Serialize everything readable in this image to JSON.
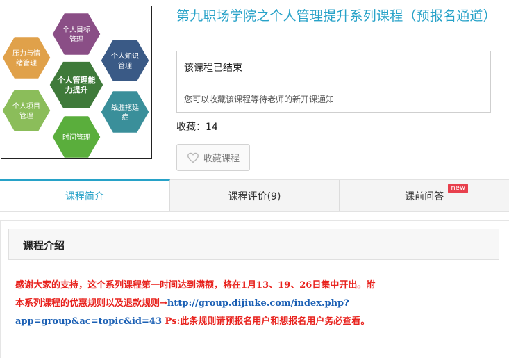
{
  "course": {
    "title": "第九职场学院之个人管理提升系列课程（预报名通道）",
    "ended_title": "该课程已结束",
    "ended_sub": "您可以收藏该课程等待老师的新开课通知",
    "fav_count_label": "收藏：14",
    "fav_button_label": "收藏课程"
  },
  "thumbnail": {
    "center": [
      "个人管理能",
      "力提升"
    ],
    "top": [
      "个人目标",
      "管理"
    ],
    "top_right": [
      "个人知识",
      "管理"
    ],
    "bottom_right": [
      "战胜拖延",
      "症"
    ],
    "bottom": [
      "时间管理"
    ],
    "bottom_left": [
      "个人项目",
      "管理"
    ],
    "top_left": [
      "压力与情",
      "绪管理"
    ],
    "colors": {
      "center": "#3f7a3a",
      "top": "#8a4e86",
      "top_right": "#3a5a86",
      "bottom_right": "#3a8f9a",
      "bottom": "#5aae3c",
      "bottom_left": "#8bbd5a",
      "top_left": "#e0a14a"
    }
  },
  "tabs": [
    {
      "label": "课程简介",
      "active": true
    },
    {
      "label": "课程评价(9)",
      "active": false
    },
    {
      "label": "课前问答",
      "active": false,
      "badge": "new"
    }
  ],
  "section": {
    "title": "课程介绍",
    "line1": "感谢大家的支持，这个系列课程第一时间达到满额，将在1月13、19、26日集中开出。附",
    "line2_red": "本系列课程的优惠规则以及退款规则→",
    "line2_link": "http://group.dijiuke.com/index.php?",
    "line3_link": "app=group&ac=topic&id=43",
    "line3_red": " Ps:此条规则请预报名用户和想报名用户务必查看。"
  },
  "colors": {
    "accent": "#27a2c8",
    "notice_red": "#e8231e",
    "link_blue": "#1a5fb4",
    "badge_red": "#e8404d"
  }
}
